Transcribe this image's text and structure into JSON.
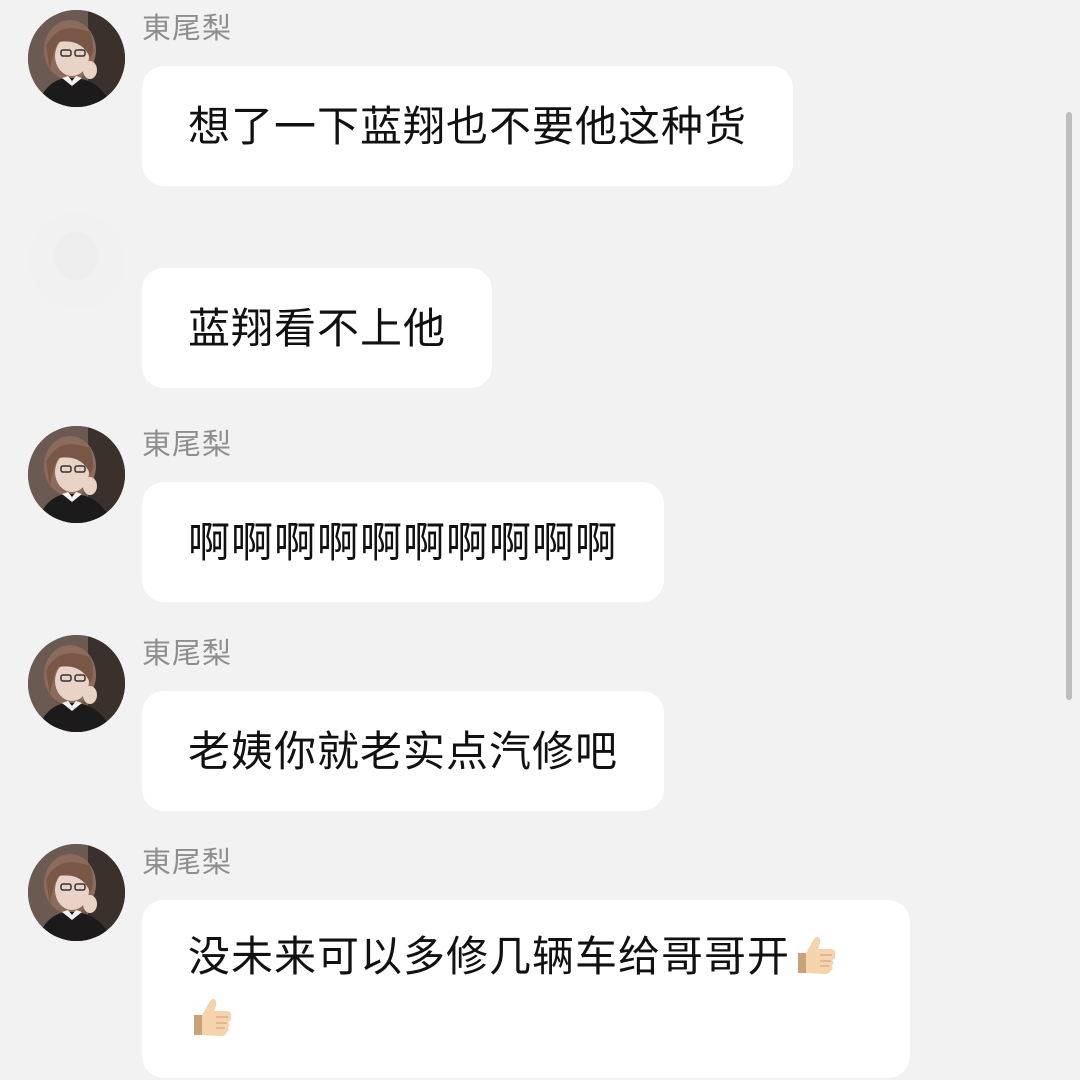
{
  "messages": [
    {
      "sender": "東尾梨",
      "text": "想了一下蓝翔也不要他这种货",
      "avatar": "avatar-portrait"
    },
    {
      "sender": "",
      "text": "蓝翔看不上他",
      "avatar": "avatar-blank"
    },
    {
      "sender": "東尾梨",
      "text": "啊啊啊啊啊啊啊啊啊啊",
      "avatar": "avatar-portrait"
    },
    {
      "sender": "東尾梨",
      "text": "老姨你就老实点汽修吧",
      "avatar": "avatar-portrait"
    },
    {
      "sender": "東尾梨",
      "text": "没未来可以多修几辆车给哥哥开",
      "avatar": "avatar-portrait",
      "trailing_emoji": [
        "thumbs-up-icon",
        "thumbs-up-icon"
      ]
    }
  ],
  "colors": {
    "background": "#f2f2f2",
    "bubble": "#ffffff",
    "sender_name": "#8e8e8e",
    "text": "#111111"
  }
}
